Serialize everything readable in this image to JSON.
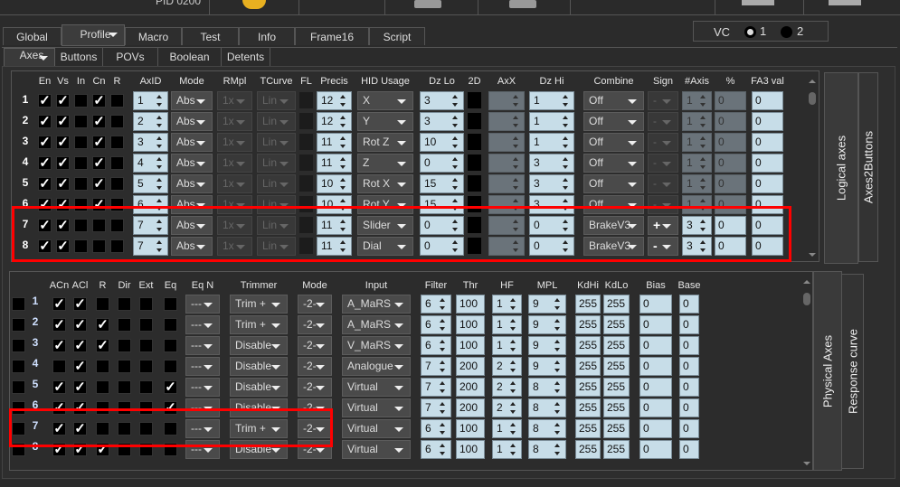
{
  "header": {
    "device_label": "PID 0200"
  },
  "tabs": [
    {
      "label": "Global"
    },
    {
      "label": "Profile",
      "selected": true
    },
    {
      "label": "Macro"
    },
    {
      "label": "Test"
    },
    {
      "label": "Info"
    },
    {
      "label": "Frame16"
    },
    {
      "label": "Script"
    }
  ],
  "subtabs": [
    {
      "label": "Axes",
      "selected": true
    },
    {
      "label": "Buttons"
    },
    {
      "label": "POVs"
    },
    {
      "label": "Boolean"
    },
    {
      "label": "Detents"
    }
  ],
  "vc": {
    "label": "VC",
    "options": [
      "1",
      "2"
    ],
    "selected": "1"
  },
  "logical": {
    "side_tabs": [
      "Logical axes",
      "Axes2Buttons"
    ],
    "headers": {
      "en": "En",
      "vs": "Vs",
      "in": "In",
      "cn": "Cn",
      "r": "R",
      "axid": "AxID",
      "mode": "Mode",
      "rmpl": "RMpl",
      "tcurve": "TCurve",
      "fl": "FL",
      "precis": "Precis",
      "hid": "HID Usage",
      "dzlo": "Dz Lo",
      "d2": "2D",
      "axx": "AxX",
      "dzhi": "Dz Hi",
      "combine": "Combine",
      "sign": "Sign",
      "naxis": "#Axis",
      "pct": "%",
      "fa3": "FA3 val"
    },
    "rows": [
      {
        "n": "1",
        "en": true,
        "vs": true,
        "in": false,
        "cn": true,
        "r": false,
        "axid": "1",
        "mode": "Abs",
        "rmpl": "1x",
        "tcurve": "Lin",
        "precis": "12",
        "hid": "X",
        "dzlo": "3",
        "axx": "",
        "dzhi": "1",
        "combine": "Off",
        "sign": "-",
        "naxis": "1",
        "pct": "0",
        "fa3": "0",
        "combined": false
      },
      {
        "n": "2",
        "en": true,
        "vs": true,
        "in": false,
        "cn": true,
        "r": false,
        "axid": "2",
        "mode": "Abs",
        "rmpl": "1x",
        "tcurve": "Lin",
        "precis": "12",
        "hid": "Y",
        "dzlo": "3",
        "axx": "",
        "dzhi": "1",
        "combine": "Off",
        "sign": "-",
        "naxis": "1",
        "pct": "0",
        "fa3": "0",
        "combined": false
      },
      {
        "n": "3",
        "en": true,
        "vs": true,
        "in": false,
        "cn": true,
        "r": false,
        "axid": "3",
        "mode": "Abs",
        "rmpl": "1x",
        "tcurve": "Lin",
        "precis": "11",
        "hid": "Rot Z",
        "dzlo": "10",
        "axx": "",
        "dzhi": "1",
        "combine": "Off",
        "sign": "-",
        "naxis": "1",
        "pct": "0",
        "fa3": "0",
        "combined": false
      },
      {
        "n": "4",
        "en": true,
        "vs": true,
        "in": false,
        "cn": true,
        "r": false,
        "axid": "4",
        "mode": "Abs",
        "rmpl": "1x",
        "tcurve": "Lin",
        "precis": "11",
        "hid": "Z",
        "dzlo": "0",
        "axx": "",
        "dzhi": "3",
        "combine": "Off",
        "sign": "-",
        "naxis": "1",
        "pct": "0",
        "fa3": "0",
        "combined": false
      },
      {
        "n": "5",
        "en": true,
        "vs": true,
        "in": false,
        "cn": true,
        "r": false,
        "axid": "5",
        "mode": "Abs",
        "rmpl": "1x",
        "tcurve": "Lin",
        "precis": "10",
        "hid": "Rot X",
        "dzlo": "15",
        "axx": "",
        "dzhi": "3",
        "combine": "Off",
        "sign": "-",
        "naxis": "1",
        "pct": "0",
        "fa3": "0",
        "combined": false
      },
      {
        "n": "6",
        "en": true,
        "vs": true,
        "in": false,
        "cn": true,
        "r": false,
        "axid": "6",
        "mode": "Abs",
        "rmpl": "1x",
        "tcurve": "Lin",
        "precis": "10",
        "hid": "Rot Y",
        "dzlo": "15",
        "axx": "",
        "dzhi": "3",
        "combine": "Off",
        "sign": "-",
        "naxis": "1",
        "pct": "0",
        "fa3": "0",
        "combined": false
      },
      {
        "n": "7",
        "en": true,
        "vs": true,
        "in": false,
        "cn": false,
        "r": false,
        "axid": "7",
        "mode": "Abs",
        "rmpl": "1x",
        "tcurve": "Lin",
        "precis": "11",
        "hid": "Slider",
        "dzlo": "0",
        "axx": "",
        "dzhi": "0",
        "combine": "BrakeV3",
        "sign": "+",
        "naxis": "3",
        "pct": "0",
        "fa3": "0",
        "combined": true
      },
      {
        "n": "8",
        "en": true,
        "vs": true,
        "in": false,
        "cn": false,
        "r": false,
        "axid": "7",
        "mode": "Abs",
        "rmpl": "1x",
        "tcurve": "Lin",
        "precis": "11",
        "hid": "Dial",
        "dzlo": "0",
        "axx": "",
        "dzhi": "0",
        "combine": "BrakeV3",
        "sign": "-",
        "naxis": "3",
        "pct": "0",
        "fa3": "0",
        "combined": true
      }
    ]
  },
  "physical": {
    "side_tabs": [
      "Physical Axes",
      "Response curve"
    ],
    "headers": {
      "acn": "ACn",
      "acl": "ACl",
      "r": "R",
      "dir": "Dir",
      "ext": "Ext",
      "eq": "Eq",
      "eqn": "Eq N",
      "trimmer": "Trimmer",
      "mode": "Mode",
      "input": "Input",
      "filter": "Filter",
      "thr": "Thr",
      "hf": "HF",
      "mpl": "MPL",
      "kdhi": "KdHi",
      "kdlo": "KdLo",
      "bias": "Bias",
      "base": "Base"
    },
    "rows": [
      {
        "n": "1",
        "sel": false,
        "acn": true,
        "acl": true,
        "r": false,
        "dir": false,
        "ext": false,
        "eq": false,
        "eqn": "---",
        "trimmer": "Trim +",
        "mode": "-2-",
        "input": "A_MaRS",
        "filter": "6",
        "thr": "100",
        "hf": "1",
        "mpl": "9",
        "kdhi": "255",
        "kdlo": "255",
        "bias": "0",
        "base": "0"
      },
      {
        "n": "2",
        "sel": false,
        "acn": true,
        "acl": true,
        "r": true,
        "dir": false,
        "ext": false,
        "eq": false,
        "eqn": "---",
        "trimmer": "Trim +",
        "mode": "-2-",
        "input": "A_MaRS",
        "filter": "6",
        "thr": "100",
        "hf": "1",
        "mpl": "9",
        "kdhi": "255",
        "kdlo": "255",
        "bias": "0",
        "base": "0"
      },
      {
        "n": "3",
        "sel": false,
        "acn": true,
        "acl": true,
        "r": true,
        "dir": false,
        "ext": false,
        "eq": false,
        "eqn": "---",
        "trimmer": "Disable",
        "mode": "-2-",
        "input": "V_MaRS",
        "filter": "6",
        "thr": "100",
        "hf": "1",
        "mpl": "9",
        "kdhi": "255",
        "kdlo": "255",
        "bias": "0",
        "base": "0"
      },
      {
        "n": "4",
        "sel": false,
        "acn": false,
        "acl": true,
        "r": false,
        "dir": false,
        "ext": false,
        "eq": false,
        "eqn": "---",
        "trimmer": "Disable",
        "mode": "-2-",
        "input": "Analogue",
        "filter": "7",
        "thr": "200",
        "hf": "2",
        "mpl": "9",
        "kdhi": "255",
        "kdlo": "255",
        "bias": "0",
        "base": "0"
      },
      {
        "n": "5",
        "sel": false,
        "acn": true,
        "acl": true,
        "r": false,
        "dir": false,
        "ext": false,
        "eq": true,
        "eqn": "---",
        "trimmer": "Disable",
        "mode": "-2-",
        "input": "Virtual",
        "filter": "7",
        "thr": "200",
        "hf": "2",
        "mpl": "8",
        "kdhi": "255",
        "kdlo": "255",
        "bias": "0",
        "base": "0"
      },
      {
        "n": "6",
        "sel": false,
        "acn": true,
        "acl": true,
        "r": false,
        "dir": false,
        "ext": false,
        "eq": true,
        "eqn": "---",
        "trimmer": "Disable",
        "mode": "-2-",
        "input": "Virtual",
        "filter": "7",
        "thr": "200",
        "hf": "2",
        "mpl": "8",
        "kdhi": "255",
        "kdlo": "255",
        "bias": "0",
        "base": "0"
      },
      {
        "n": "7",
        "sel": false,
        "acn": true,
        "acl": true,
        "r": false,
        "dir": false,
        "ext": false,
        "eq": false,
        "eqn": "---",
        "trimmer": "Trim +",
        "mode": "-2-",
        "input": "Virtual",
        "filter": "6",
        "thr": "100",
        "hf": "1",
        "mpl": "8",
        "kdhi": "255",
        "kdlo": "255",
        "bias": "0",
        "base": "0"
      },
      {
        "n": "8",
        "sel": false,
        "acn": true,
        "acl": true,
        "r": true,
        "dir": false,
        "ext": false,
        "eq": false,
        "eqn": "---",
        "trimmer": "Disable",
        "mode": "-2-",
        "input": "Virtual",
        "filter": "6",
        "thr": "100",
        "hf": "1",
        "mpl": "8",
        "kdhi": "255",
        "kdlo": "255",
        "bias": "0",
        "base": "0"
      }
    ]
  },
  "highlight_color": "#ff0000"
}
